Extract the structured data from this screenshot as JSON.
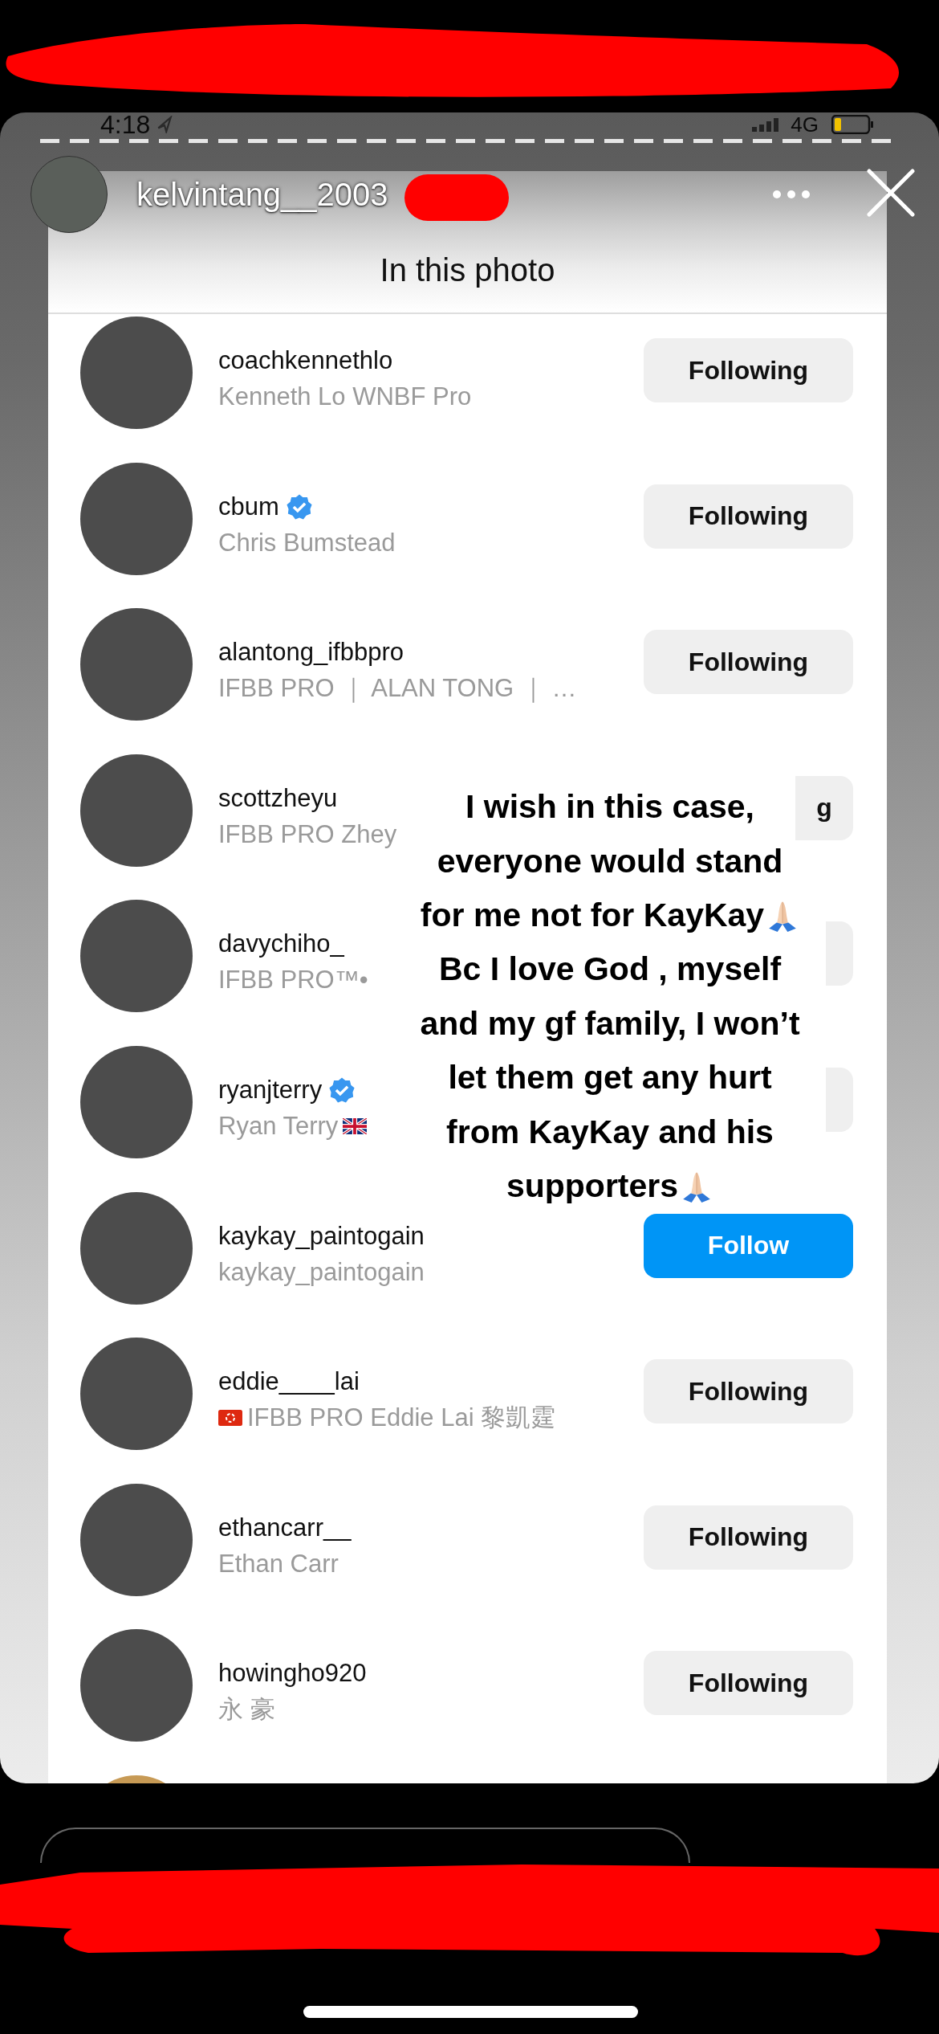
{
  "status_bar": {
    "time": "4:18",
    "network": "4G"
  },
  "author": {
    "username": "kelvintang__2003"
  },
  "sheet": {
    "title": "In this photo",
    "rows": [
      {
        "kind": "user",
        "username": "coachkennethlo",
        "subtitle": "Kenneth Lo WNBF Pro",
        "button": {
          "kind": "following",
          "label": "Following"
        }
      },
      {
        "kind": "user",
        "username": "cbum",
        "verified": true,
        "subtitle": "Chris Bumstead",
        "button": {
          "kind": "following",
          "label": "Following"
        }
      },
      {
        "kind": "user",
        "username": "alantong_ifbbpro",
        "subtitle": "IFBB PRO ｜ ALAN TONG ｜ …",
        "button": {
          "kind": "following",
          "label": "Following"
        }
      },
      {
        "kind": "user",
        "username": "scottzheyu",
        "subtitle": "IFBB PRO Zhey",
        "button": {
          "kind": "following_sliver",
          "label": "g"
        }
      },
      {
        "kind": "user",
        "username": "davychiho_",
        "subtitle": "IFBB PRO™•",
        "button": {
          "kind": "following_sliver"
        }
      },
      {
        "kind": "user",
        "username": "ryanjterry",
        "verified": true,
        "subtitle": "Ryan Terry",
        "flag_after": {
          "kind": "gb"
        },
        "button": {
          "kind": "following_sliver"
        }
      },
      {
        "kind": "user",
        "username": "kaykay_paintogain",
        "subtitle": "kaykay_paintogain",
        "button": {
          "kind": "follow",
          "label": "Follow"
        }
      },
      {
        "kind": "user",
        "username": "eddie____lai",
        "flag_before": {
          "kind": "hk"
        },
        "subtitle": "IFBB PRO Eddie Lai 黎凱霆",
        "button": {
          "kind": "following",
          "label": "Following"
        }
      },
      {
        "kind": "user",
        "username": "ethancarr__",
        "subtitle": "Ethan Carr",
        "button": {
          "kind": "following",
          "label": "Following"
        }
      },
      {
        "kind": "user",
        "username": "howingho920",
        "subtitle": "永 豪",
        "button": {
          "kind": "following",
          "label": "Following"
        }
      },
      {
        "kind": "partial"
      }
    ]
  },
  "caption": {
    "lines": [
      {
        "text": "I wish in this case,"
      },
      {
        "text": "everyone would stand"
      },
      {
        "text": "for me not for KayKay",
        "emoji": {
          "kind": "pray"
        }
      },
      {
        "text": "Bc I love God , myself"
      },
      {
        "text": "and my gf family, I won’t"
      },
      {
        "text": "let them get any hurt"
      },
      {
        "text": "from KayKay and his"
      },
      {
        "text": "supporters",
        "emoji": {
          "kind": "pray"
        }
      }
    ]
  }
}
